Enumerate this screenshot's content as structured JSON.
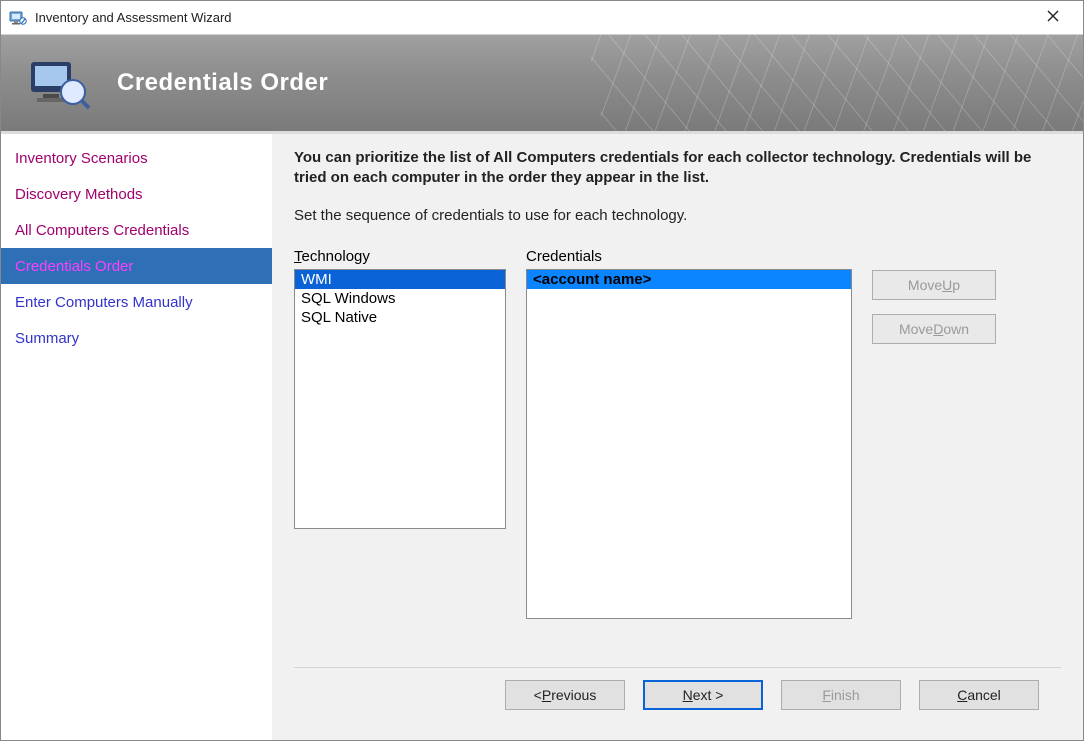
{
  "window": {
    "title": "Inventory and Assessment Wizard"
  },
  "banner": {
    "title": "Credentials Order"
  },
  "sidebar": {
    "items": [
      {
        "label": "Inventory Scenarios",
        "state": "visited"
      },
      {
        "label": "Discovery Methods",
        "state": "visited"
      },
      {
        "label": "All Computers Credentials",
        "state": "visited"
      },
      {
        "label": "Credentials Order",
        "state": "current"
      },
      {
        "label": "Enter Computers Manually",
        "state": ""
      },
      {
        "label": "Summary",
        "state": ""
      }
    ]
  },
  "content": {
    "heading": "You can prioritize the list of All Computers credentials for each collector technology. Credentials will be tried on each computer in the order they appear in the list.",
    "subtext": "Set the sequence of credentials to use for each technology.",
    "technology_label_pre": "T",
    "technology_label_rest": "echnology",
    "credentials_label_pre": "C",
    "credentials_label_rest": "redentials",
    "technology_items": [
      {
        "label": "WMI",
        "selected": true
      },
      {
        "label": "SQL Windows",
        "selected": false
      },
      {
        "label": "SQL Native",
        "selected": false
      }
    ],
    "credentials_items": [
      {
        "label": "<account name>",
        "selected": true
      }
    ],
    "move_up": {
      "pre": "Move ",
      "ul": "U",
      "post": "p"
    },
    "move_down": {
      "pre": "Move ",
      "ul": "D",
      "post": "own"
    }
  },
  "footer": {
    "previous": {
      "pre": "< ",
      "ul": "P",
      "post": "revious"
    },
    "next": {
      "pre": "",
      "ul": "N",
      "post": "ext >"
    },
    "finish": {
      "pre": "",
      "ul": "F",
      "post": "inish"
    },
    "cancel": {
      "pre": "",
      "ul": "C",
      "post": "ancel"
    }
  }
}
